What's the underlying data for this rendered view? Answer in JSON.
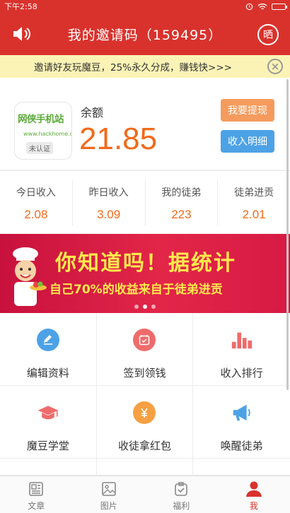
{
  "status_bar": {
    "time": "下午2:58"
  },
  "header": {
    "title": "我的邀请码（159495）",
    "share_label": "晒"
  },
  "notice": {
    "text": "邀请好友玩魔豆，25%永久分成，赚钱快>>>"
  },
  "profile": {
    "logo_brand": "网侠手机站",
    "logo_url": "www.hackhome.com",
    "logo_badge": "未认证",
    "balance_label": "余额",
    "balance_value": "21.85",
    "withdraw_label": "我要提现",
    "detail_label": "收入明细"
  },
  "stats": [
    {
      "label": "今日收入",
      "value": "2.08"
    },
    {
      "label": "昨日收入",
      "value": "3.09"
    },
    {
      "label": "我的徒弟",
      "value": "223"
    },
    {
      "label": "徒弟进贡",
      "value": "2.01"
    }
  ],
  "banner": {
    "headline": "你知道吗！据统计",
    "subline": "自己70%的收益来自于徒弟进贡",
    "slides": 3,
    "active_slide": 2
  },
  "grid": [
    {
      "label": "编辑资料",
      "icon": "pencil-icon",
      "color": "#4da2e6"
    },
    {
      "label": "签到领钱",
      "icon": "calendar-check-icon",
      "color": "#ef6b6b"
    },
    {
      "label": "收入排行",
      "icon": "bar-chart-icon",
      "color": "#ef6b6b"
    },
    {
      "label": "魔豆学堂",
      "icon": "graduation-cap-icon",
      "color": "#ef6b6b"
    },
    {
      "label": "收徒拿红包",
      "icon": "yen-coin-icon",
      "color": "#f5a043"
    },
    {
      "label": "唤醒徒弟",
      "icon": "megaphone-icon",
      "color": "#4da2e6"
    }
  ],
  "tabs": [
    {
      "label": "文章",
      "icon": "article-icon",
      "active": false
    },
    {
      "label": "图片",
      "icon": "image-icon",
      "active": false
    },
    {
      "label": "福利",
      "icon": "gift-check-icon",
      "active": false
    },
    {
      "label": "我",
      "icon": "person-icon",
      "active": true
    }
  ],
  "colors": {
    "primary": "#d9322c",
    "accent": "#f26a1b",
    "blue": "#4da2e6"
  }
}
